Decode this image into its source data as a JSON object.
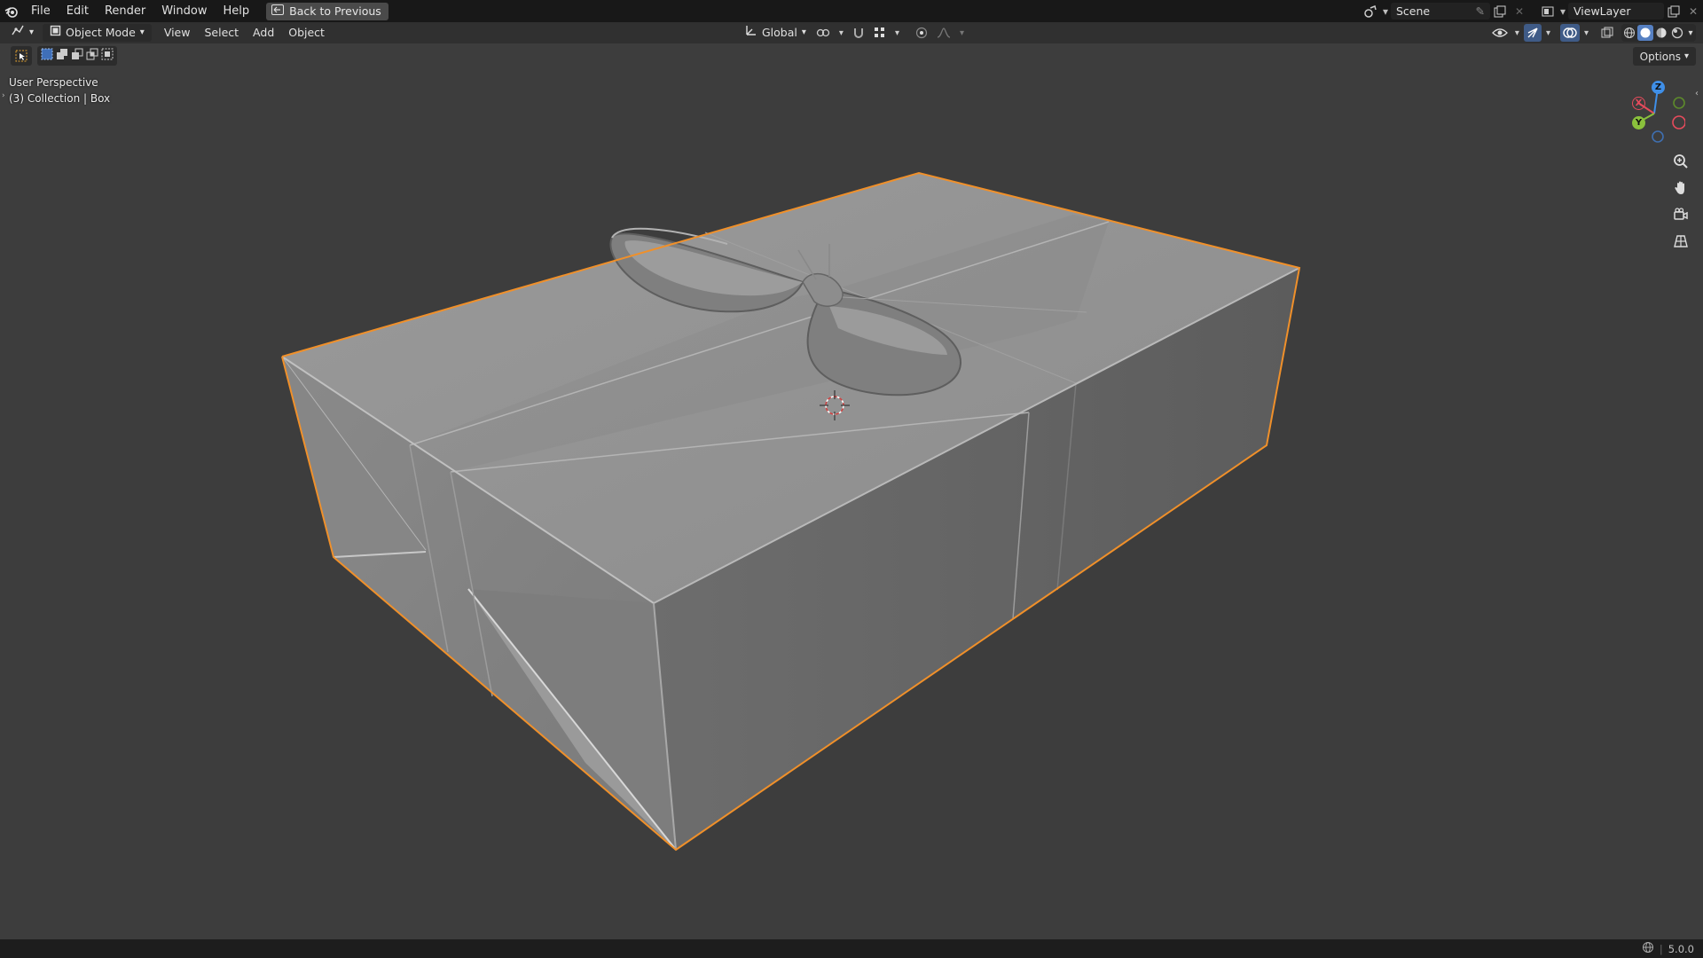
{
  "topbar": {
    "menus": [
      "File",
      "Edit",
      "Render",
      "Window",
      "Help"
    ],
    "back_label": "Back to Previous",
    "scene_label": "Scene",
    "viewlayer_label": "ViewLayer"
  },
  "viewport_header": {
    "mode_label": "Object Mode",
    "menus": [
      "View",
      "Select",
      "Add",
      "Object"
    ],
    "orientation_label": "Global"
  },
  "options_label": "Options",
  "viewport": {
    "perspective_label": "User Perspective",
    "collection_label": "(3) Collection | Box"
  },
  "gizmo": {
    "x_label": "X",
    "y_label": "Y",
    "z_label": "Z",
    "colors": {
      "x": "#e84b5c",
      "y": "#8ac13c",
      "z": "#3f8fe8"
    }
  },
  "statusbar": {
    "version": "5.0.0"
  },
  "colors": {
    "selection_outline": "#f0902a",
    "background": "#3d3d3d",
    "active_button": "#3f5b87"
  }
}
